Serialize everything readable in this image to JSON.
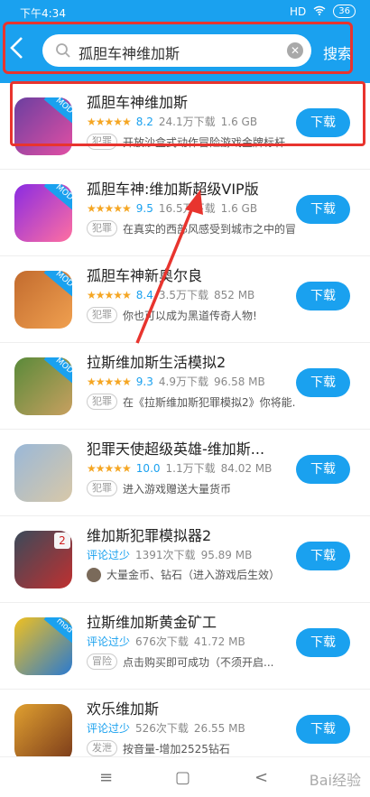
{
  "status_bar": {
    "time": "下午4:34",
    "signal": "HD",
    "battery": "36"
  },
  "search": {
    "query": "孤胆车神维加斯",
    "button_label": "搜索"
  },
  "download_label": "下载",
  "apps": [
    {
      "title": "孤胆车神维加斯",
      "rating": "8.2",
      "downloads": "24.1万下载",
      "size": "1.6 GB",
      "tag": "犯罪",
      "desc": "开放沙盒式动作冒险游戏金牌标杆...",
      "mod": "MOD",
      "icon_colors": [
        "#6b3fa0",
        "#e24fa4"
      ]
    },
    {
      "title": "孤胆车神:维加斯超级VIP版",
      "rating": "9.5",
      "downloads": "16.5万下载",
      "size": "1.6 GB",
      "tag": "犯罪",
      "desc": "在真实的西部风感受到城市之中的冒...",
      "mod": "MOD",
      "icon_colors": [
        "#8a2be2",
        "#ff6fa1"
      ]
    },
    {
      "title": "孤胆车神新奥尔良",
      "rating": "8.4",
      "downloads": "3.5万下载",
      "size": "852 MB",
      "tag": "犯罪",
      "desc": "你也可以成为黑道传奇人物!",
      "mod": "MOD",
      "icon_colors": [
        "#c26b2e",
        "#f0a050"
      ]
    },
    {
      "title": "拉斯维加斯生活模拟2",
      "rating": "9.3",
      "downloads": "4.9万下载",
      "size": "96.58 MB",
      "tag": "犯罪",
      "desc": "在《拉斯维加斯犯罪模拟2》你将能...",
      "mod": "MOD",
      "icon_colors": [
        "#5a8a3a",
        "#c8a060"
      ]
    },
    {
      "title": "犯罪天使超级英雄-维加斯...",
      "rating": "10.0",
      "downloads": "1.1万下载",
      "size": "84.02 MB",
      "tag": "犯罪",
      "desc": "进入游戏赠送大量货币",
      "mod": "",
      "icon_colors": [
        "#9ab8d8",
        "#d8c8a8"
      ]
    },
    {
      "title": "维加斯犯罪模拟器2",
      "review": "评论过少",
      "downloads": "1391次下载",
      "size": "95.89 MB",
      "desc": "大量金币、钻石（进入游戏后生效）",
      "badge": "2",
      "icon_colors": [
        "#3a4a5a",
        "#c03030"
      ]
    },
    {
      "title": "拉斯维加斯黄金矿工",
      "review": "评论过少",
      "downloads": "676次下载",
      "size": "41.72 MB",
      "tag": "冒险",
      "desc": "点击购买即可成功（不须开启...",
      "mod": "mod",
      "icon_colors": [
        "#f0c020",
        "#2a7ad0"
      ]
    },
    {
      "title": "欢乐维加斯",
      "review": "评论过少",
      "downloads": "526次下载",
      "size": "26.55 MB",
      "tag": "发泄",
      "desc": "按音量-增加2525钻石",
      "mod": "",
      "icon_colors": [
        "#e0a030",
        "#7a3a1a"
      ]
    }
  ],
  "nav": {
    "menu": "≡",
    "home": "▢",
    "back": "<"
  },
  "watermark": "Bai经验"
}
